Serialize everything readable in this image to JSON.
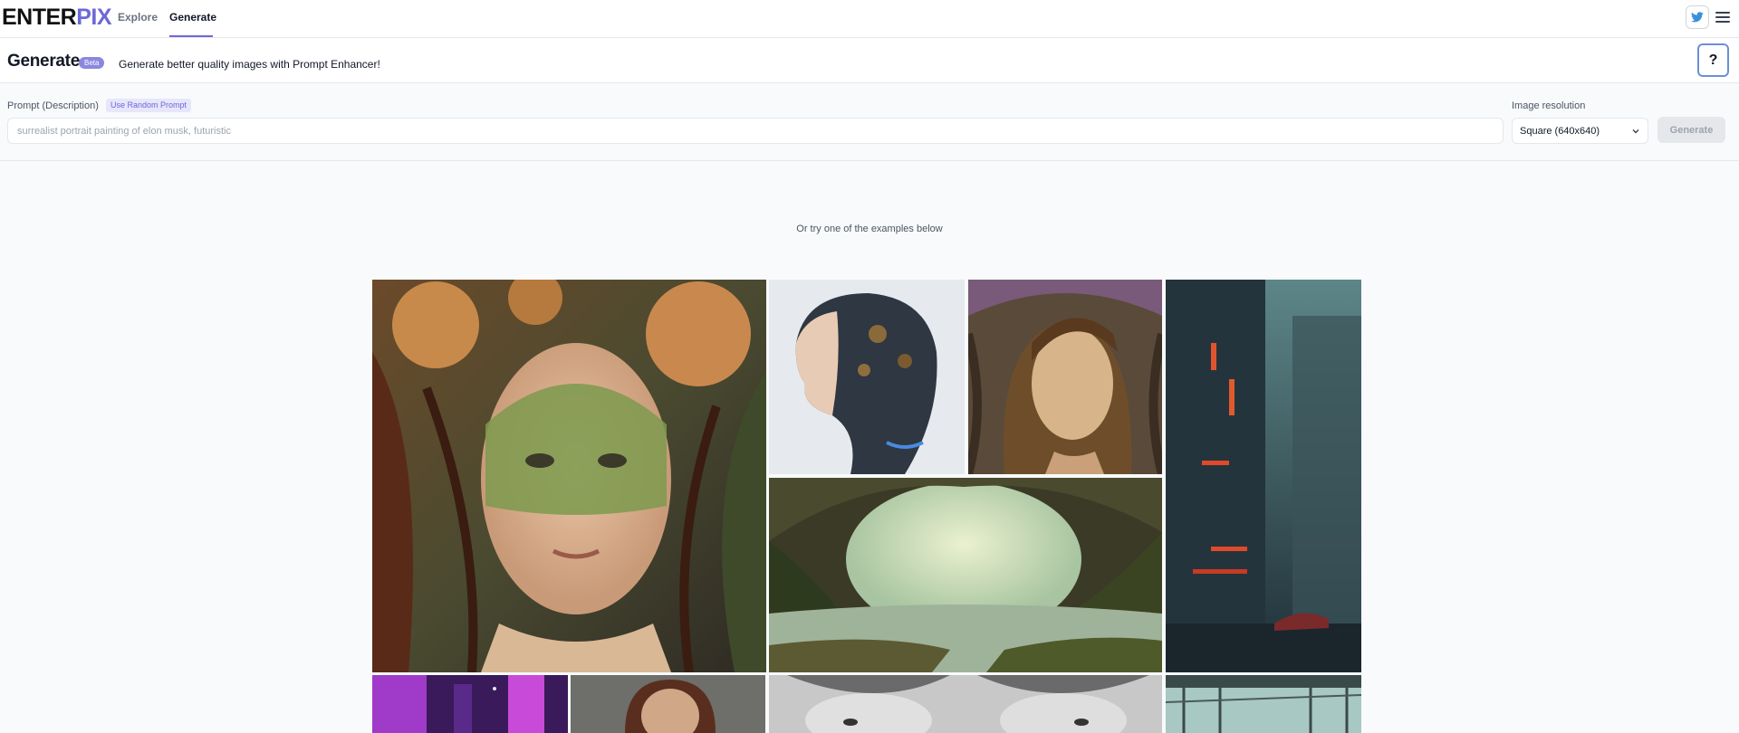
{
  "brand": {
    "logo_part1": "ENTER",
    "logo_part2": "PIX",
    "accent_color": "#6d68d8"
  },
  "nav": {
    "explore": "Explore",
    "generate": "Generate",
    "active": "Generate"
  },
  "header_icons": {
    "twitter": "twitter-icon",
    "menu": "hamburger-menu-icon"
  },
  "page": {
    "title": "Generate",
    "badge": "Beta",
    "subtitle": "Generate better quality images with Prompt Enhancer!",
    "help_label": "?"
  },
  "form": {
    "prompt_label": "Prompt (Description)",
    "random_prompt": "Use Random Prompt",
    "prompt_value": "",
    "prompt_placeholder": "surrealist portrait painting of elon musk, futuristic",
    "resolution_label": "Image resolution",
    "resolution_value": "Square (640x640)",
    "generate_label": "Generate"
  },
  "examples": {
    "hint": "Or try one of the examples below",
    "items": [
      {
        "name": "example-forest-queen-portrait",
        "subject": "woman with floral crown and green mask"
      },
      {
        "name": "example-cyborg-woman-profile",
        "subject": "cyborg woman side profile"
      },
      {
        "name": "example-art-nouveau-man",
        "subject": "art nouveau portrait of a long-haired man"
      },
      {
        "name": "example-cyberpunk-tower",
        "subject": "futuristic city tower in fog"
      },
      {
        "name": "example-cave-lake-landscape",
        "subject": "cave arch over a lake"
      },
      {
        "name": "example-neon-city",
        "subject": "neon purple cityscape"
      },
      {
        "name": "example-woman-portrait",
        "subject": "portrait of a woman"
      },
      {
        "name": "example-greek-statue",
        "subject": "marble bust statue"
      },
      {
        "name": "example-bridge-structure",
        "subject": "steel bridge structure"
      }
    ]
  }
}
